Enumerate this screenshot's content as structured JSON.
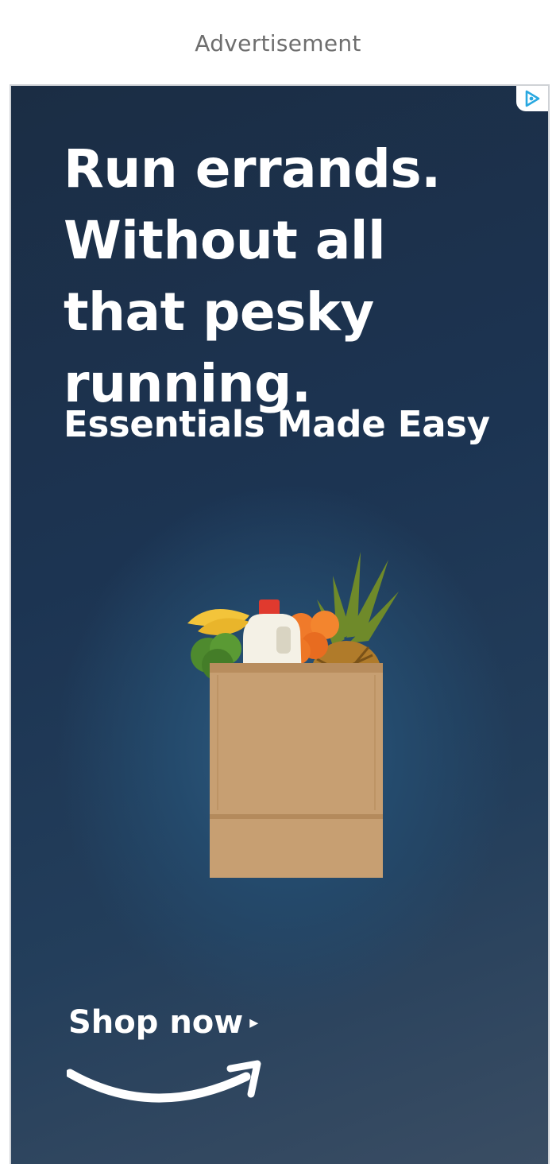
{
  "ad_label": "Advertisement",
  "ad": {
    "headline_lines": [
      "Run errands.",
      "Without all",
      "that pesky",
      "running."
    ],
    "subheadline": "Essentials Made Easy",
    "cta_label": "Shop now",
    "cta_arrow": "▸",
    "image": "paper-grocery-bag-with-produce",
    "logo": "amazon-smile-logo",
    "adchoices_icon": "adchoices-icon",
    "colors": {
      "background": "#1c3452",
      "text": "#ffffff",
      "bag": "#c49a6c",
      "adchoices": "#29a8e0"
    }
  }
}
